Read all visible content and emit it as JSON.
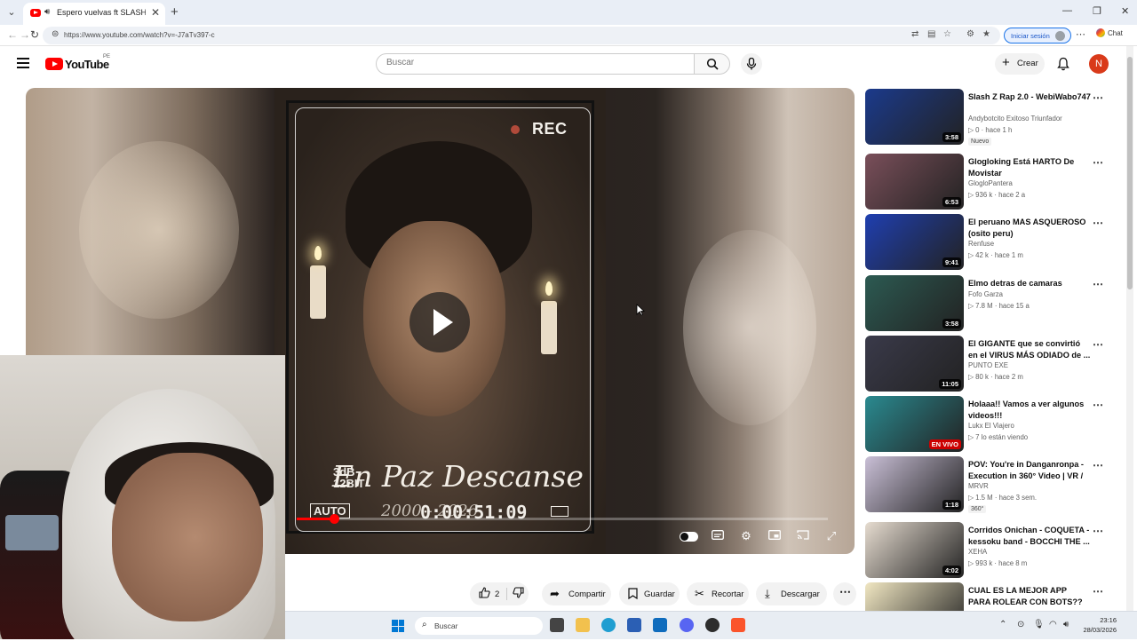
{
  "browser": {
    "tab_title": "Espero vuelvas ft SLASHPDF",
    "url": "https://www.youtube.com/watch?v=-J7aTv397-c",
    "signin_label": "Iniciar sesión",
    "chat_label": "Chat"
  },
  "youtube": {
    "logo_text": "YouTube",
    "country_code": "PE",
    "search_placeholder": "Buscar",
    "create_label": "Crear",
    "avatar_initial": "N"
  },
  "video": {
    "rec_text": "REC",
    "bit_label_line1": "3dB",
    "bit_label_line2": "12BIT",
    "auto_label": "AUTO",
    "epitaph": "En Paz Descanse",
    "years": "2000 - 2026",
    "timecode": "0:00:51:09",
    "progress_fraction": 0.07
  },
  "actions": {
    "like_count": "2",
    "share_label": "Compartir",
    "save_label": "Guardar",
    "clip_label": "Recortar",
    "download_label": "Descargar"
  },
  "recommendations": [
    {
      "title": "Slash Z Rap 2.0 - WebiWabo747",
      "channel": "Andybotcito Exitoso Triunfador",
      "meta": "▷ 0 · hace 1 h",
      "duration": "3:58",
      "badge": "Nuevo",
      "thumb_color": "#1b3a8c"
    },
    {
      "title": "Glogloking Está HARTO De Movistar",
      "channel": "GlogloPantera",
      "meta": "▷ 936 k · hace 2 a",
      "duration": "6:53",
      "thumb_color": "#7a4f5a"
    },
    {
      "title": "El peruano MAS ASQUEROSO (osito peru)",
      "channel": "Renfuse",
      "meta": "▷ 42 k · hace 1 m",
      "duration": "9:41",
      "thumb_color": "#1f3fb0"
    },
    {
      "title": "Elmo detras de camaras",
      "channel": "Fofo Garza",
      "meta": "▷ 7.8 M · hace 15 a",
      "duration": "3:58",
      "thumb_color": "#2c5a52"
    },
    {
      "title": "El GIGANTE que se convirtió en el VIRUS MÁS ODIADO de ...",
      "channel": "PUNTO EXE",
      "meta": "▷ 80 k · hace 2 m",
      "duration": "11:05",
      "thumb_color": "#3a3a4a"
    },
    {
      "title": "Holaaa!! Vamos a ver algunos videos!!!",
      "channel": "Lukx El Viajero",
      "meta": "▷ 7 lo están viendo",
      "live": "EN VIVO",
      "thumb_color": "#2a8a90"
    },
    {
      "title": "POV: You're in Danganronpa - Execution in 360° Video | VR / ...",
      "channel": "MRVR",
      "meta": "▷ 1.5 M · hace 3 sem.",
      "duration": "1:18",
      "badge": "360°",
      "thumb_color": "#c9bfd6"
    },
    {
      "title": "Corridos Onichan - COQUETA - kessoku band - BOCCHI THE ...",
      "channel": "XEHA",
      "meta": "▷ 993 k · hace 8 m",
      "duration": "4:02",
      "thumb_color": "#e6dcd0"
    },
    {
      "title": "CUAL ES LA MEJOR APP PARA ROLEAR CON BOTS??",
      "channel": "",
      "meta": "",
      "thumb_color": "#f1e7c2"
    }
  ],
  "taskbar": {
    "search_label": "Buscar",
    "time": "23:16",
    "date": "28/03/2026"
  }
}
